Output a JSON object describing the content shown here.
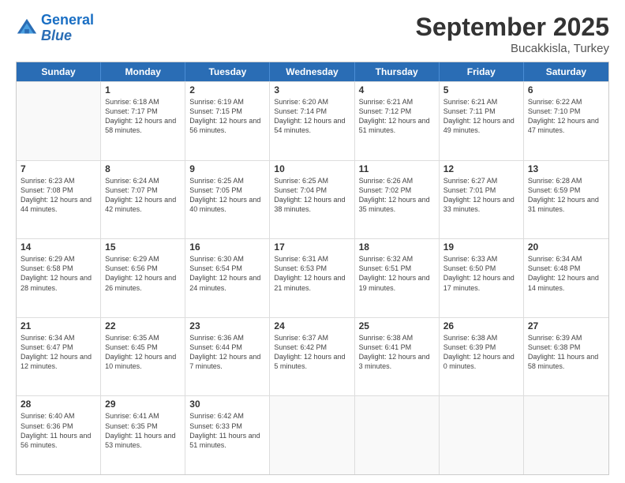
{
  "header": {
    "logo_line1": "General",
    "logo_line2": "Blue",
    "month": "September 2025",
    "location": "Bucakkisla, Turkey"
  },
  "days_of_week": [
    "Sunday",
    "Monday",
    "Tuesday",
    "Wednesday",
    "Thursday",
    "Friday",
    "Saturday"
  ],
  "weeks": [
    [
      {
        "day": "",
        "sunrise": "",
        "sunset": "",
        "daylight": ""
      },
      {
        "day": "1",
        "sunrise": "Sunrise: 6:18 AM",
        "sunset": "Sunset: 7:17 PM",
        "daylight": "Daylight: 12 hours and 58 minutes."
      },
      {
        "day": "2",
        "sunrise": "Sunrise: 6:19 AM",
        "sunset": "Sunset: 7:15 PM",
        "daylight": "Daylight: 12 hours and 56 minutes."
      },
      {
        "day": "3",
        "sunrise": "Sunrise: 6:20 AM",
        "sunset": "Sunset: 7:14 PM",
        "daylight": "Daylight: 12 hours and 54 minutes."
      },
      {
        "day": "4",
        "sunrise": "Sunrise: 6:21 AM",
        "sunset": "Sunset: 7:12 PM",
        "daylight": "Daylight: 12 hours and 51 minutes."
      },
      {
        "day": "5",
        "sunrise": "Sunrise: 6:21 AM",
        "sunset": "Sunset: 7:11 PM",
        "daylight": "Daylight: 12 hours and 49 minutes."
      },
      {
        "day": "6",
        "sunrise": "Sunrise: 6:22 AM",
        "sunset": "Sunset: 7:10 PM",
        "daylight": "Daylight: 12 hours and 47 minutes."
      }
    ],
    [
      {
        "day": "7",
        "sunrise": "Sunrise: 6:23 AM",
        "sunset": "Sunset: 7:08 PM",
        "daylight": "Daylight: 12 hours and 44 minutes."
      },
      {
        "day": "8",
        "sunrise": "Sunrise: 6:24 AM",
        "sunset": "Sunset: 7:07 PM",
        "daylight": "Daylight: 12 hours and 42 minutes."
      },
      {
        "day": "9",
        "sunrise": "Sunrise: 6:25 AM",
        "sunset": "Sunset: 7:05 PM",
        "daylight": "Daylight: 12 hours and 40 minutes."
      },
      {
        "day": "10",
        "sunrise": "Sunrise: 6:25 AM",
        "sunset": "Sunset: 7:04 PM",
        "daylight": "Daylight: 12 hours and 38 minutes."
      },
      {
        "day": "11",
        "sunrise": "Sunrise: 6:26 AM",
        "sunset": "Sunset: 7:02 PM",
        "daylight": "Daylight: 12 hours and 35 minutes."
      },
      {
        "day": "12",
        "sunrise": "Sunrise: 6:27 AM",
        "sunset": "Sunset: 7:01 PM",
        "daylight": "Daylight: 12 hours and 33 minutes."
      },
      {
        "day": "13",
        "sunrise": "Sunrise: 6:28 AM",
        "sunset": "Sunset: 6:59 PM",
        "daylight": "Daylight: 12 hours and 31 minutes."
      }
    ],
    [
      {
        "day": "14",
        "sunrise": "Sunrise: 6:29 AM",
        "sunset": "Sunset: 6:58 PM",
        "daylight": "Daylight: 12 hours and 28 minutes."
      },
      {
        "day": "15",
        "sunrise": "Sunrise: 6:29 AM",
        "sunset": "Sunset: 6:56 PM",
        "daylight": "Daylight: 12 hours and 26 minutes."
      },
      {
        "day": "16",
        "sunrise": "Sunrise: 6:30 AM",
        "sunset": "Sunset: 6:54 PM",
        "daylight": "Daylight: 12 hours and 24 minutes."
      },
      {
        "day": "17",
        "sunrise": "Sunrise: 6:31 AM",
        "sunset": "Sunset: 6:53 PM",
        "daylight": "Daylight: 12 hours and 21 minutes."
      },
      {
        "day": "18",
        "sunrise": "Sunrise: 6:32 AM",
        "sunset": "Sunset: 6:51 PM",
        "daylight": "Daylight: 12 hours and 19 minutes."
      },
      {
        "day": "19",
        "sunrise": "Sunrise: 6:33 AM",
        "sunset": "Sunset: 6:50 PM",
        "daylight": "Daylight: 12 hours and 17 minutes."
      },
      {
        "day": "20",
        "sunrise": "Sunrise: 6:34 AM",
        "sunset": "Sunset: 6:48 PM",
        "daylight": "Daylight: 12 hours and 14 minutes."
      }
    ],
    [
      {
        "day": "21",
        "sunrise": "Sunrise: 6:34 AM",
        "sunset": "Sunset: 6:47 PM",
        "daylight": "Daylight: 12 hours and 12 minutes."
      },
      {
        "day": "22",
        "sunrise": "Sunrise: 6:35 AM",
        "sunset": "Sunset: 6:45 PM",
        "daylight": "Daylight: 12 hours and 10 minutes."
      },
      {
        "day": "23",
        "sunrise": "Sunrise: 6:36 AM",
        "sunset": "Sunset: 6:44 PM",
        "daylight": "Daylight: 12 hours and 7 minutes."
      },
      {
        "day": "24",
        "sunrise": "Sunrise: 6:37 AM",
        "sunset": "Sunset: 6:42 PM",
        "daylight": "Daylight: 12 hours and 5 minutes."
      },
      {
        "day": "25",
        "sunrise": "Sunrise: 6:38 AM",
        "sunset": "Sunset: 6:41 PM",
        "daylight": "Daylight: 12 hours and 3 minutes."
      },
      {
        "day": "26",
        "sunrise": "Sunrise: 6:38 AM",
        "sunset": "Sunset: 6:39 PM",
        "daylight": "Daylight: 12 hours and 0 minutes."
      },
      {
        "day": "27",
        "sunrise": "Sunrise: 6:39 AM",
        "sunset": "Sunset: 6:38 PM",
        "daylight": "Daylight: 11 hours and 58 minutes."
      }
    ],
    [
      {
        "day": "28",
        "sunrise": "Sunrise: 6:40 AM",
        "sunset": "Sunset: 6:36 PM",
        "daylight": "Daylight: 11 hours and 56 minutes."
      },
      {
        "day": "29",
        "sunrise": "Sunrise: 6:41 AM",
        "sunset": "Sunset: 6:35 PM",
        "daylight": "Daylight: 11 hours and 53 minutes."
      },
      {
        "day": "30",
        "sunrise": "Sunrise: 6:42 AM",
        "sunset": "Sunset: 6:33 PM",
        "daylight": "Daylight: 11 hours and 51 minutes."
      },
      {
        "day": "",
        "sunrise": "",
        "sunset": "",
        "daylight": ""
      },
      {
        "day": "",
        "sunrise": "",
        "sunset": "",
        "daylight": ""
      },
      {
        "day": "",
        "sunrise": "",
        "sunset": "",
        "daylight": ""
      },
      {
        "day": "",
        "sunrise": "",
        "sunset": "",
        "daylight": ""
      }
    ]
  ]
}
